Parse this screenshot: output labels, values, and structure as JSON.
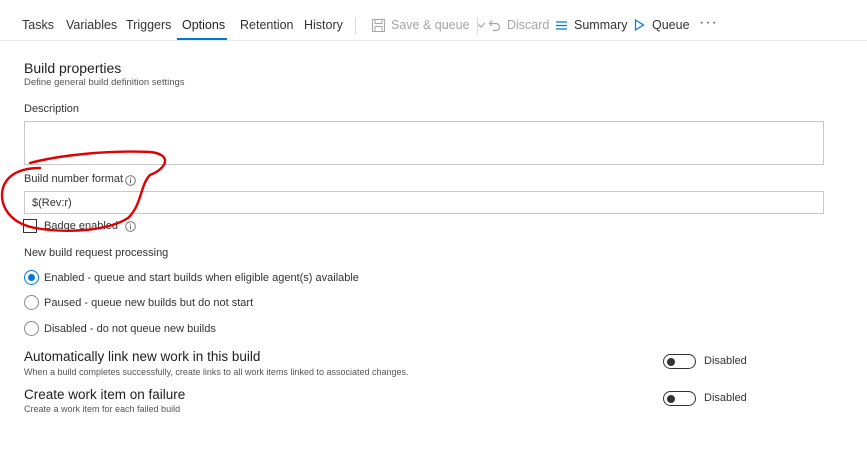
{
  "tabs": [
    {
      "label": "Tasks",
      "active": false
    },
    {
      "label": "Variables",
      "active": false
    },
    {
      "label": "Triggers",
      "active": false
    },
    {
      "label": "Options",
      "active": true
    },
    {
      "label": "Retention",
      "active": false
    },
    {
      "label": "History",
      "active": false
    }
  ],
  "commands": {
    "save": {
      "label": "Save & queue",
      "icon": "save-icon",
      "disabled": true
    },
    "discard": {
      "label": "Discard",
      "icon": "undo-icon",
      "disabled": true
    },
    "summary": {
      "label": "Summary",
      "icon": "list-icon",
      "disabled": false
    },
    "queue": {
      "label": "Queue",
      "icon": "play-icon",
      "disabled": false
    },
    "more": "···"
  },
  "build_properties": {
    "title": "Build properties",
    "subtitle": "Define general build definition settings",
    "description_label": "Description",
    "description_value": "",
    "build_number_label": "Build number format",
    "build_number_value": "$(Rev:r)",
    "badge_label": "Badge enabled",
    "badge_checked": false
  },
  "request_processing": {
    "label": "New build request processing",
    "options": [
      {
        "label": "Enabled - queue and start builds when eligible agent(s) available",
        "checked": true
      },
      {
        "label": "Paused - queue new builds but do not start",
        "checked": false
      },
      {
        "label": "Disabled - do not queue new builds",
        "checked": false
      }
    ]
  },
  "auto_link": {
    "title": "Automatically link new work in this build",
    "description": "When a build completes successfully, create links to all work items linked to associated changes.",
    "toggle_state": "Disabled",
    "enabled": false
  },
  "work_item": {
    "title": "Create work item on failure",
    "description": "Create a work item for each failed build",
    "toggle_state": "Disabled",
    "enabled": false
  },
  "colors": {
    "accent": "#0078d4",
    "annotation": "#e00000",
    "disabled_text": "#a6a6a6"
  }
}
